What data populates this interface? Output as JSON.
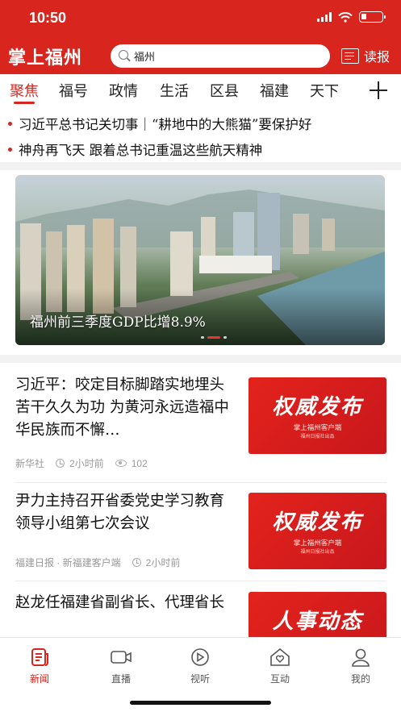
{
  "status": {
    "time": "10:50"
  },
  "header": {
    "logo": "掌上福州",
    "search_text": "福州",
    "read_paper": "读报"
  },
  "tabs": [
    "聚焦",
    "福号",
    "政情",
    "生活",
    "区县",
    "福建",
    "天下"
  ],
  "headlines": [
    "习近平总书记关切事｜“耕地中的大熊猫”要保护好",
    "神舟再飞天 跟着总书记重温这些航天精神"
  ],
  "banner": {
    "caption": "福州前三季度GDP比增8.9%"
  },
  "articles": [
    {
      "title": "习近平：咬定目标脚踏实地埋头苦干久久为功 为黄河永远造福中华民族而不懈…",
      "source": "新华社",
      "time": "2小时前",
      "views": "102",
      "thumb_big": "权威发布",
      "thumb_small": "掌上福州客户端",
      "thumb_tiny": "福州日报社出品"
    },
    {
      "title": "尹力主持召开省委党史学习教育领导小组第七次会议",
      "source": "福建日报 · 新福建客户端",
      "time": "2小时前",
      "thumb_big": "权威发布",
      "thumb_small": "掌上福州客户端",
      "thumb_tiny": "福州日报社出品"
    },
    {
      "title": "赵龙任福建省副省长、代理省长",
      "thumb_big": "人事动态"
    }
  ],
  "tabbar": [
    "新闻",
    "直播",
    "视听",
    "互动",
    "我的"
  ],
  "colors": {
    "brand_red": "#d8261f"
  }
}
